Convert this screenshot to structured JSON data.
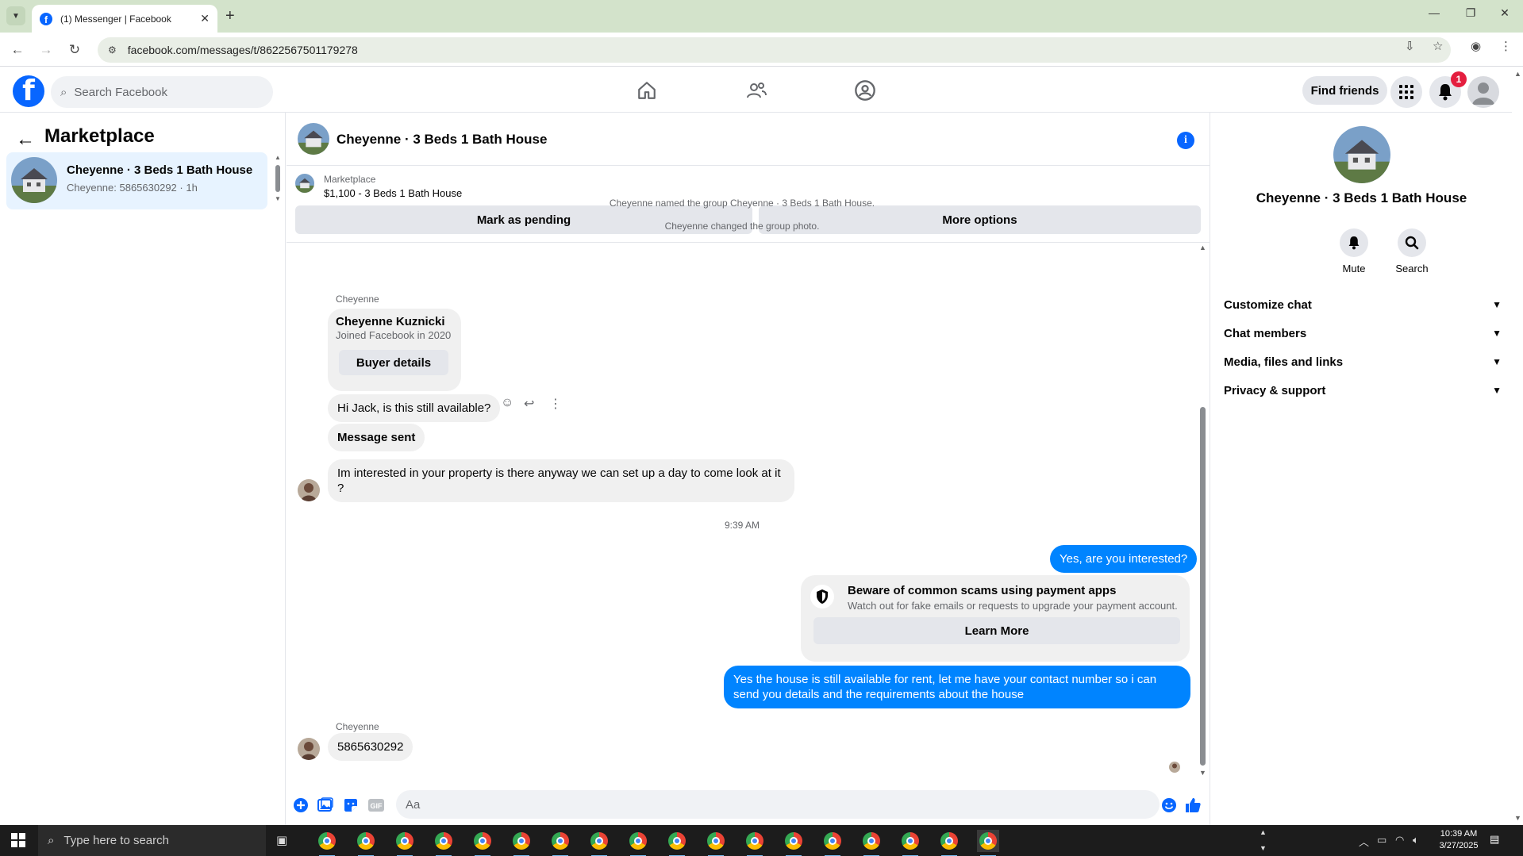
{
  "browser": {
    "tab_title": "(1) Messenger | Facebook",
    "url": "facebook.com/messages/t/8622567501179278"
  },
  "topbar": {
    "search_placeholder": "Search Facebook",
    "find_friends": "Find friends",
    "notification_count": "1"
  },
  "left_panel": {
    "title": "Marketplace",
    "threads": [
      {
        "name": "Cheyenne · 3 Beds 1 Bath House",
        "subtitle": "Cheyenne: 5865630292 · 1h"
      }
    ]
  },
  "chat": {
    "title": "Cheyenne · 3 Beds 1 Bath House",
    "listing": {
      "label": "Marketplace",
      "title": "$1,100 - 3 Beds 1 Bath House",
      "mark_pending": "Mark as pending",
      "more_options": "More options"
    },
    "system_messages": [
      "Cheyenne named the group Cheyenne · 3 Beds 1 Bath House.",
      "Cheyenne changed the group photo."
    ],
    "sender_name": "Cheyenne",
    "buyer_card": {
      "name": "Cheyenne Kuznicki",
      "joined": "Joined Facebook in 2020",
      "button": "Buyer details"
    },
    "messages_in": [
      "Hi Jack, is this still available?",
      "Message sent",
      "Im interested in your property is there anyway we can set up a day to come look at it ?"
    ],
    "timestamp": "9:39 AM",
    "messages_out": [
      "Yes, are you interested?",
      "Yes the house is still available for rent, let me have your contact number so i can send you details and the requirements about the house"
    ],
    "scam_warning": {
      "title": "Beware of common scams using payment apps",
      "subtitle": "Watch out for fake emails or requests to upgrade your payment account.",
      "button": "Learn More"
    },
    "last_sender": "Cheyenne",
    "last_message": "5865630292",
    "composer_placeholder": "Aa"
  },
  "right_panel": {
    "name": "Cheyenne · 3 Beds 1 Bath House",
    "actions": [
      "Mute",
      "Search"
    ],
    "sections": [
      "Customize chat",
      "Chat members",
      "Media, files and links",
      "Privacy & support"
    ]
  },
  "taskbar": {
    "search_placeholder": "Type here to search",
    "time": "10:39 AM",
    "date": "3/27/2025"
  },
  "colors": {
    "accent": "#0866ff",
    "outgoing_bubble": "#0084ff",
    "selected_thread": "#e7f3ff",
    "badge": "#e41e3f"
  }
}
